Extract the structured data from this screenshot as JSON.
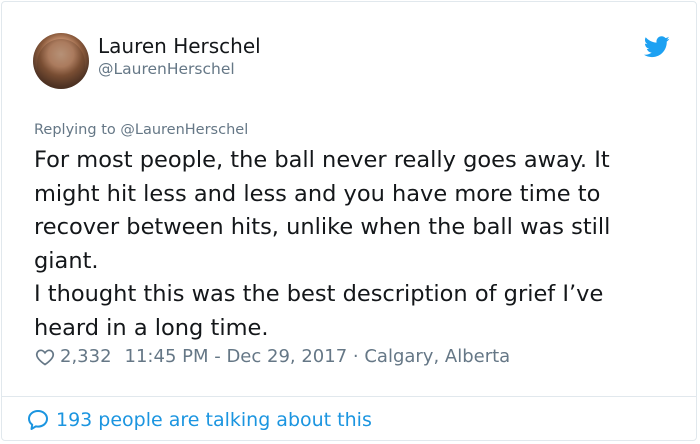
{
  "tweet": {
    "author_name": "Lauren Herschel",
    "author_handle": "@LaurenHerschel",
    "replying_prefix": "Replying to ",
    "replying_handle": "@LaurenHerschel",
    "text_paragraph_1": "For most people, the ball never really goes away. It might hit less and less and you have more time to recover between hits, unlike when the ball was still giant.",
    "text_paragraph_2": "I thought this was the best description of grief I’ve heard in a long time.",
    "likes": "2,332",
    "timestamp": "11:45 PM - Dec 29, 2017",
    "location_separator": " · ",
    "location": "Calgary, Alberta",
    "conversation_text": "193 people are talking about this"
  },
  "icons": {
    "brand": "twitter-bird-icon",
    "like": "heart-outline-icon",
    "reply": "speech-bubble-icon"
  },
  "colors": {
    "brand_blue": "#1da1f2",
    "link_blue": "#1b95e0",
    "text_primary": "#14171a",
    "text_secondary": "#657786",
    "border": "#e1e8ed"
  }
}
